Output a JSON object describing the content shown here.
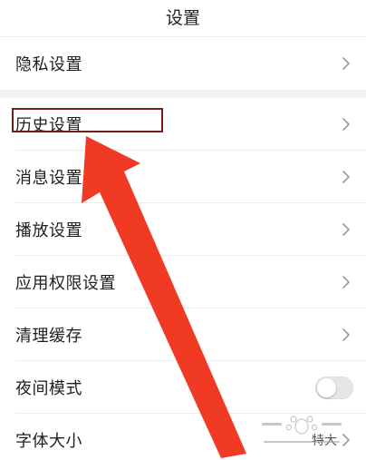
{
  "header": {
    "title": "设置"
  },
  "settings": {
    "items": [
      {
        "label": "隐私设置"
      },
      {
        "label": "历史设置"
      },
      {
        "label": "消息设置"
      },
      {
        "label": "播放设置"
      },
      {
        "label": "应用权限设置"
      },
      {
        "label": "清理缓存"
      },
      {
        "label": "夜间模式",
        "toggle_on": false
      },
      {
        "label": "字体大小",
        "value": "特大"
      }
    ]
  },
  "icons": {
    "chevron": "chevron-right-icon",
    "arrow": "red-arrow-annotation",
    "watermark": "baidu-jingyan-watermark"
  },
  "colors": {
    "arrow": "#f03a24",
    "highlight_box": "#7a1b1b",
    "toggle_off": "#e6e6e6",
    "chevron": "#9a9a9a"
  }
}
